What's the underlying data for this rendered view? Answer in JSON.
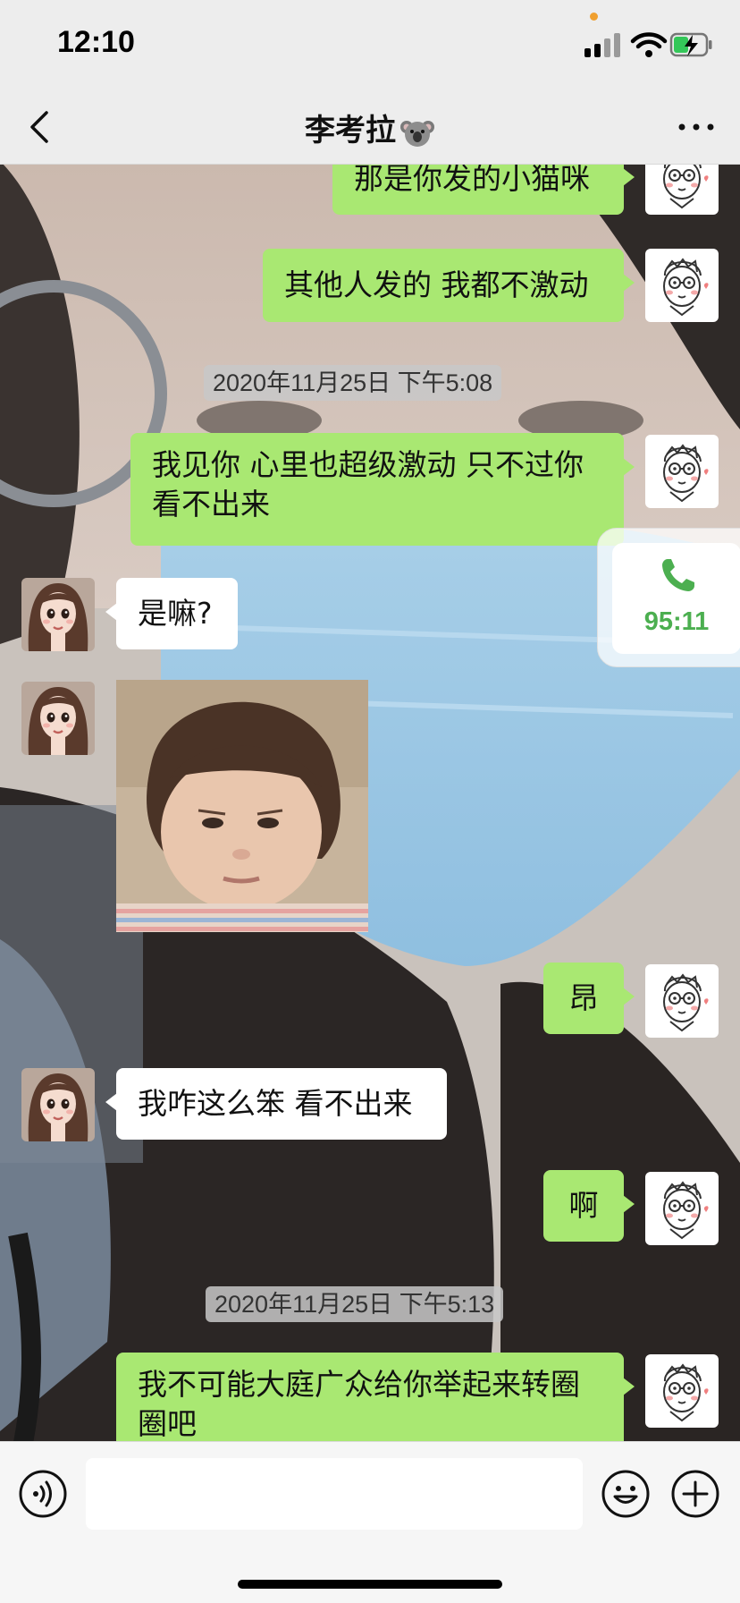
{
  "status_bar": {
    "time": "12:10"
  },
  "header": {
    "title": "李考拉"
  },
  "messages": [
    {
      "side": "me",
      "text": "那是你发的小猫咪"
    },
    {
      "side": "me",
      "text": "其他人发的 我都不激动"
    },
    {
      "type": "timestamp",
      "text": "2020年11月25日 下午5:08"
    },
    {
      "side": "me",
      "lines": [
        "我见你 心里也超级激动 只不过你",
        "看不出来"
      ]
    },
    {
      "side": "other",
      "text": "是嘛?"
    },
    {
      "side": "other",
      "type": "sticker",
      "icon": "toddler-sticker"
    },
    {
      "side": "me",
      "text": "昂"
    },
    {
      "side": "other",
      "text": "我咋这么笨 看不出来"
    },
    {
      "side": "me",
      "text": "啊"
    },
    {
      "type": "timestamp",
      "text": "2020年11月25日 下午5:13"
    },
    {
      "side": "me",
      "lines": [
        "我不可能大庭广众给你举起来转圈",
        "圈吧"
      ]
    }
  ],
  "call_widget": {
    "duration": "95:11",
    "icon": "phone-icon"
  },
  "input_bar": {
    "value": "",
    "voice_icon": "voice-icon",
    "emoji_icon": "emoji-icon",
    "plus_icon": "plus-icon"
  },
  "colors": {
    "my_bubble": "#a9e872",
    "other_bubble": "#ffffff",
    "call_green": "#4caf50",
    "bar_bg": "#ededed"
  }
}
